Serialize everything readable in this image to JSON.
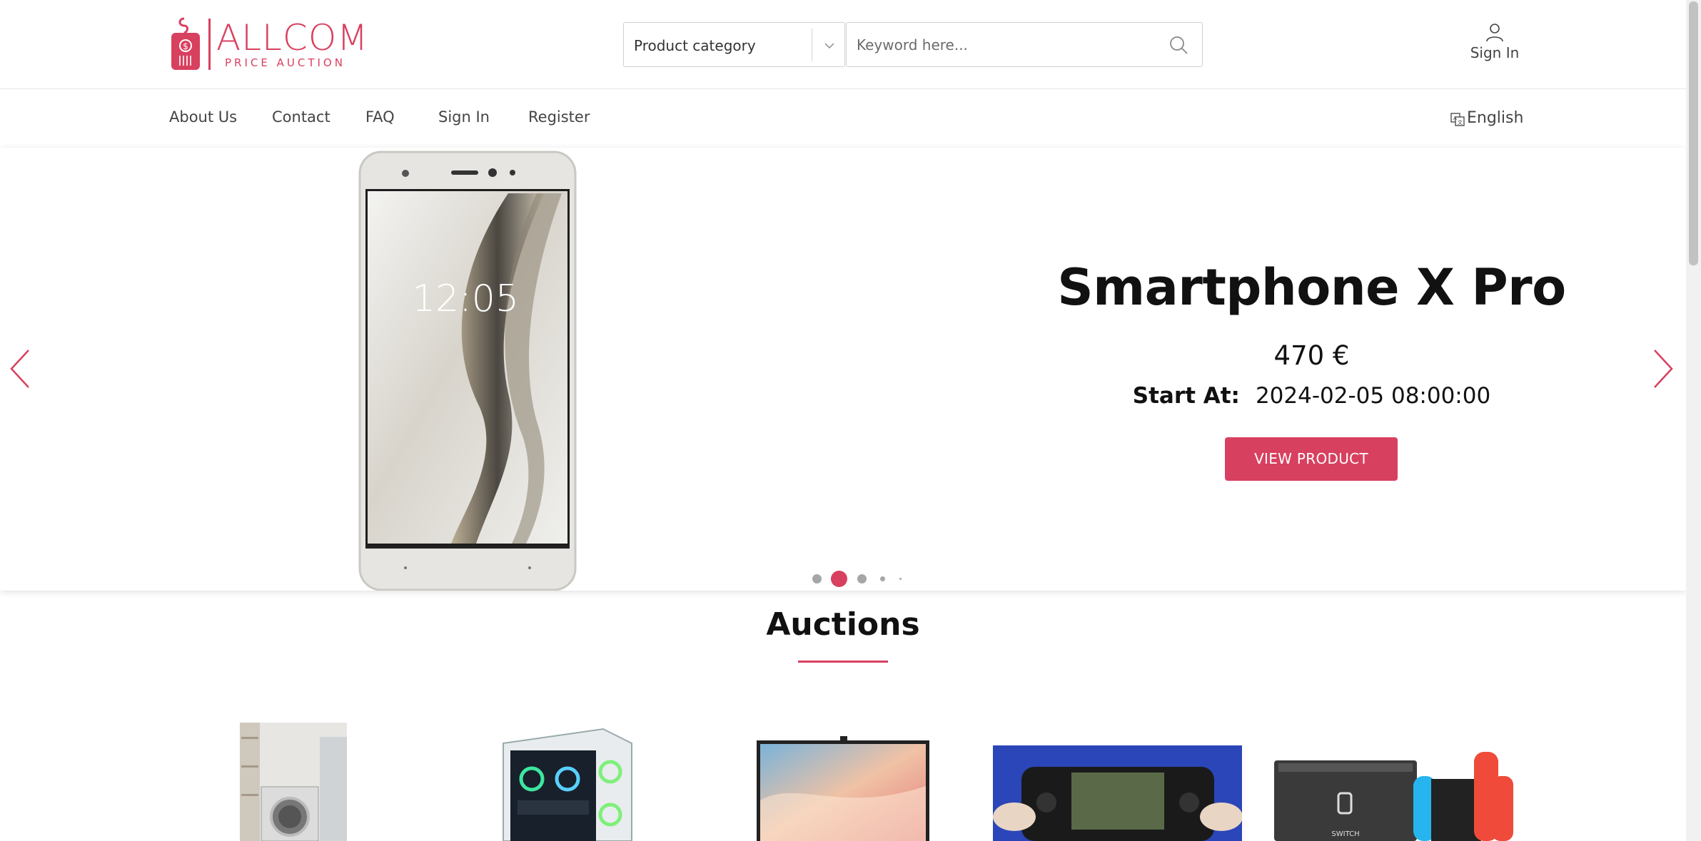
{
  "header": {
    "logo_name": "ALLCOM",
    "logo_sub": "PRICE AUCTION",
    "category_label": "Product category",
    "search_placeholder": "Keyword here...",
    "signin_label": "Sign In"
  },
  "nav": {
    "items": [
      "About Us",
      "Contact",
      "FAQ",
      "Sign In",
      "Register"
    ],
    "language": "English"
  },
  "hero": {
    "title": "Smartphone X Pro",
    "price": "470 €",
    "start_label": "Start At:",
    "start_value": "2024-02-05 08:00:00",
    "button_label": "VIEW PRODUCT",
    "phone_time": "12:05",
    "slides_total": 5,
    "active_slide": 2
  },
  "auctions": {
    "title": "Auctions",
    "products": [
      "washing-machine",
      "gaming-pc",
      "monitor",
      "handheld-console",
      "nintendo-switch"
    ]
  },
  "colors": {
    "accent": "#d8405f",
    "text": "#111111",
    "dot_inactive": "#a6a6a6"
  }
}
